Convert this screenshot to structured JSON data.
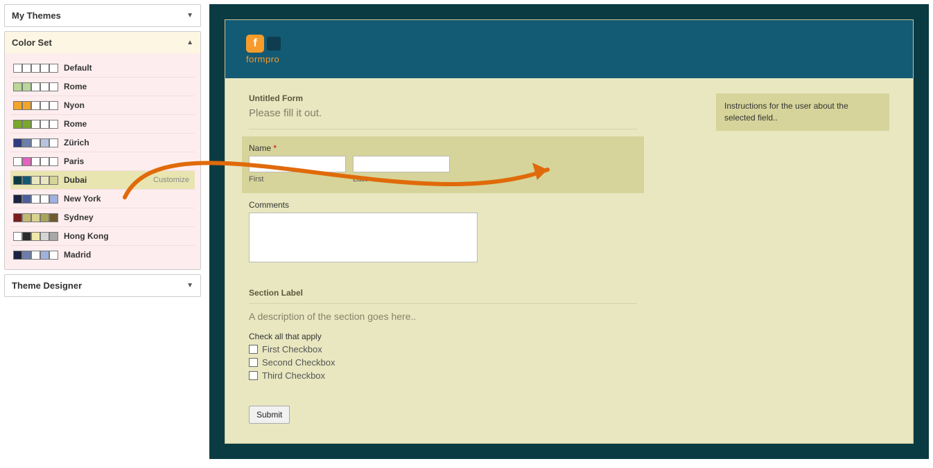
{
  "sidebar": {
    "my_themes_title": "My Themes",
    "color_set_title": "Color Set",
    "theme_designer_title": "Theme Designer",
    "customize_label": "Customize",
    "items": [
      {
        "name": "Default",
        "swatches": [
          "#ffffff",
          "#ffffff",
          "#ffffff",
          "#ffffff",
          "#ffffff"
        ]
      },
      {
        "name": "Rome",
        "swatches": [
          "#b9d89a",
          "#b9d89a",
          "#ffffff",
          "#ffffff",
          "#ffffff"
        ]
      },
      {
        "name": "Nyon",
        "swatches": [
          "#f2a52b",
          "#f2a52b",
          "#ffffff",
          "#ffffff",
          "#ffffff"
        ]
      },
      {
        "name": "Rome",
        "swatches": [
          "#7aa82c",
          "#7aa82c",
          "#ffffff",
          "#ffffff",
          "#ffffff"
        ]
      },
      {
        "name": "Zürich",
        "swatches": [
          "#2e3d80",
          "#6a7fb0",
          "#ffffff",
          "#b7c4e0",
          "#ffffff"
        ]
      },
      {
        "name": "Paris",
        "swatches": [
          "#ffffff",
          "#e85fc0",
          "#ffffff",
          "#ffffff",
          "#ffffff"
        ]
      },
      {
        "name": "Dubai",
        "swatches": [
          "#0b3b42",
          "#135a74",
          "#e8e7c0",
          "#e8e7c0",
          "#d6d49a"
        ]
      },
      {
        "name": "New York",
        "swatches": [
          "#1b2340",
          "#4b5fa0",
          "#ffffff",
          "#ffffff",
          "#9fb1dc"
        ]
      },
      {
        "name": "Sydney",
        "swatches": [
          "#7a1d1d",
          "#c2ba6e",
          "#d9d28f",
          "#a8a45a",
          "#6d5b2f"
        ]
      },
      {
        "name": "Hong Kong",
        "swatches": [
          "#ffffff",
          "#2b2b2b",
          "#f0e9a8",
          "#d4d4d4",
          "#a8a8a8"
        ]
      },
      {
        "name": "Madrid",
        "swatches": [
          "#1b2340",
          "#6a7fb0",
          "#ffffff",
          "#9fb1dc",
          "#ffffff"
        ]
      }
    ],
    "selected_index": 6
  },
  "form": {
    "logo_text": "formpro",
    "title": "Untitled Form",
    "hint": "Please fill it out.",
    "name": {
      "label": "Name",
      "required_mark": "*",
      "first_sub": "First",
      "last_sub": "Last"
    },
    "comments_label": "Comments",
    "section": {
      "label": "Section Label",
      "desc": "A description of the section goes here.."
    },
    "checks": {
      "label": "Check all that apply",
      "items": [
        "First Checkbox",
        "Second Checkbox",
        "Third Checkbox"
      ]
    },
    "submit_label": "Submit",
    "instructions": "Instructions for the user about the selected field.."
  }
}
